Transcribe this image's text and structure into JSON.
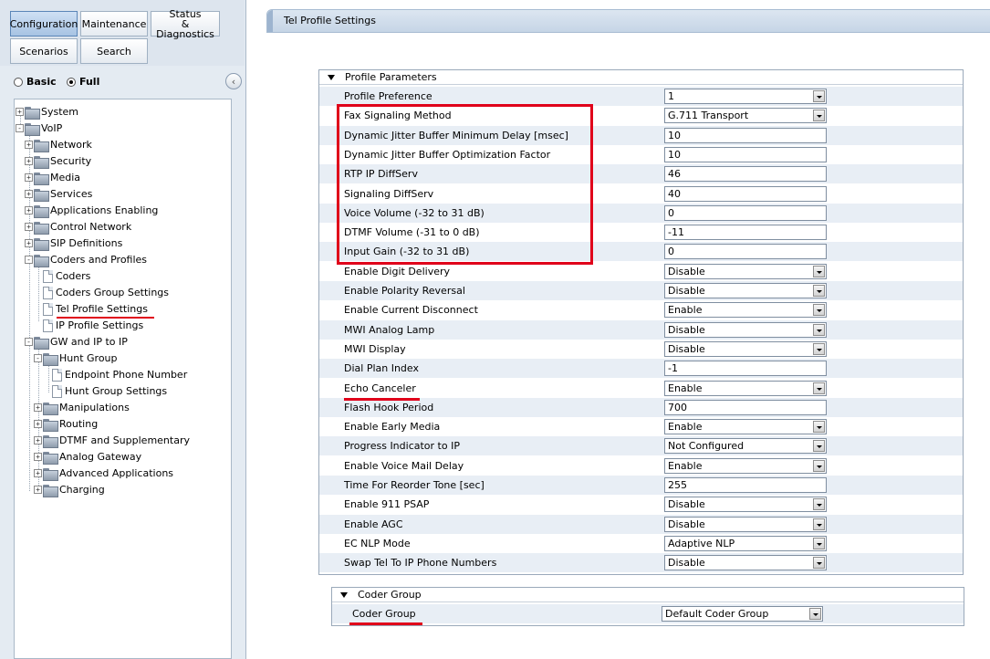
{
  "nav": {
    "tabs": [
      {
        "label": "Configuration",
        "active": true
      },
      {
        "label": "Maintenance",
        "active": false
      },
      {
        "label": "Status & Diagnostics",
        "line1": "Status",
        "line2": "& Diagnostics",
        "active": false
      },
      {
        "label": "Scenarios",
        "active": false
      },
      {
        "label": "Search",
        "active": false
      }
    ],
    "mode": {
      "basic": "Basic",
      "full": "Full",
      "selected": "Full"
    }
  },
  "tree": {
    "system": "System",
    "voip": "VoIP",
    "network": "Network",
    "security": "Security",
    "media": "Media",
    "services": "Services",
    "applications_enabling": "Applications Enabling",
    "control_network": "Control Network",
    "sip_definitions": "SIP Definitions",
    "coders_and_profiles": "Coders and Profiles",
    "coders": "Coders",
    "coders_group_settings": "Coders Group Settings",
    "tel_profile_settings": "Tel Profile Settings",
    "ip_profile_settings": "IP Profile Settings",
    "gw_and_ip_to_ip": "GW and IP to IP",
    "hunt_group": "Hunt Group",
    "endpoint_phone_number": "Endpoint Phone Number",
    "hunt_group_settings": "Hunt Group Settings",
    "manipulations": "Manipulations",
    "routing": "Routing",
    "dtmf_and_supplementary": "DTMF and Supplementary",
    "analog_gateway": "Analog Gateway",
    "advanced_applications": "Advanced Applications",
    "charging": "Charging"
  },
  "page": {
    "title": "Tel Profile Settings"
  },
  "profile_parameters": {
    "header": "Profile Parameters",
    "rows": [
      {
        "label": "Profile Preference",
        "type": "select",
        "value": "1"
      },
      {
        "label": "Fax Signaling Method",
        "type": "select",
        "value": "G.711 Transport"
      },
      {
        "label": "Dynamic Jitter Buffer Minimum Delay [msec]",
        "type": "input",
        "value": "10"
      },
      {
        "label": "Dynamic Jitter Buffer Optimization Factor",
        "type": "input",
        "value": "10"
      },
      {
        "label": "RTP IP DiffServ",
        "type": "input",
        "value": "46"
      },
      {
        "label": "Signaling DiffServ",
        "type": "input",
        "value": "40"
      },
      {
        "label": "Voice Volume (-32 to 31 dB)",
        "type": "input",
        "value": "0"
      },
      {
        "label": "DTMF Volume (-31 to 0 dB)",
        "type": "input",
        "value": "-11"
      },
      {
        "label": "Input Gain (-32 to 31 dB)",
        "type": "input",
        "value": "0"
      },
      {
        "label": "Enable Digit Delivery",
        "type": "select",
        "value": "Disable"
      },
      {
        "label": "Enable Polarity Reversal",
        "type": "select",
        "value": "Disable"
      },
      {
        "label": "Enable Current Disconnect",
        "type": "select",
        "value": "Enable"
      },
      {
        "label": "MWI Analog Lamp",
        "type": "select",
        "value": "Disable"
      },
      {
        "label": "MWI Display",
        "type": "select",
        "value": "Disable"
      },
      {
        "label": "Dial Plan Index",
        "type": "input",
        "value": "-1"
      },
      {
        "label": "Echo Canceler",
        "type": "select",
        "value": "Enable"
      },
      {
        "label": "Flash Hook Period",
        "type": "input",
        "value": "700"
      },
      {
        "label": "Enable Early Media",
        "type": "select",
        "value": "Enable"
      },
      {
        "label": "Progress Indicator to IP",
        "type": "select",
        "value": "Not Configured"
      },
      {
        "label": "Enable Voice Mail Delay",
        "type": "select",
        "value": "Enable"
      },
      {
        "label": "Time For Reorder Tone [sec]",
        "type": "input",
        "value": "255"
      },
      {
        "label": "Enable 911 PSAP",
        "type": "select",
        "value": "Disable"
      },
      {
        "label": "Enable AGC",
        "type": "select",
        "value": "Disable"
      },
      {
        "label": "EC NLP Mode",
        "type": "select",
        "value": "Adaptive NLP"
      },
      {
        "label": "Swap Tel To IP Phone Numbers",
        "type": "select",
        "value": "Disable"
      }
    ]
  },
  "coder_group": {
    "header": "Coder Group",
    "label": "Coder Group",
    "value": "Default Coder Group"
  },
  "colors": {
    "highlight": "#e0001a",
    "row_alt": "#e8eef5",
    "active_tab": "#a7c3e3"
  },
  "icons": {
    "folder": "folder-icon",
    "page": "page-icon",
    "expand": "plus-box-icon",
    "collapse": "minus-box-icon",
    "dropdown": "chevron-down-icon",
    "section_toggle": "triangle-down-icon",
    "panel_collapse": "collapse-left-icon"
  }
}
